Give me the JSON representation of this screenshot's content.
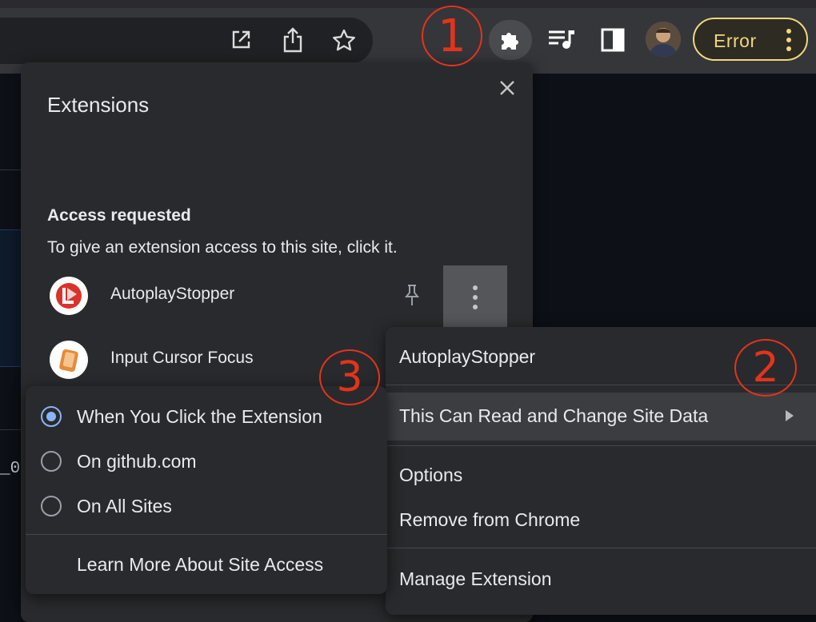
{
  "toolbar": {
    "icons": [
      "open-in-new-icon",
      "share-icon",
      "bookmark-star-icon",
      "puzzle-icon",
      "media-queue-icon",
      "side-panel-icon"
    ],
    "error_label": "Error"
  },
  "annotations": {
    "step1": "1",
    "step2": "2",
    "step3": "3",
    "color": "#e5331a"
  },
  "extensions_panel": {
    "title": "Extensions",
    "section_heading": "Access requested",
    "section_description": "To give an extension access to this site, click it.",
    "items": [
      {
        "name": "AutoplayStopper",
        "icon": "autoplaystopper-icon"
      },
      {
        "name": "Input Cursor Focus",
        "icon": "input-cursor-focus-icon"
      }
    ]
  },
  "context_menu": {
    "header": "AutoplayStopper",
    "items": [
      {
        "label": "This Can Read and Change Site Data",
        "has_submenu": true
      },
      {
        "label": "Options"
      },
      {
        "label": "Remove from Chrome"
      },
      {
        "label": "Manage Extension"
      }
    ]
  },
  "site_access_submenu": {
    "options": [
      {
        "label": "When You Click the Extension",
        "selected": true
      },
      {
        "label": "On github.com",
        "selected": false
      },
      {
        "label": "On All Sites",
        "selected": false
      }
    ],
    "link": "Learn More About Site Access"
  },
  "background": {
    "code_fragment": "_0"
  },
  "colors": {
    "error_accent": "#f2d680",
    "radio_selected": "#8ab4f8",
    "panel_bg": "#292a2d"
  }
}
